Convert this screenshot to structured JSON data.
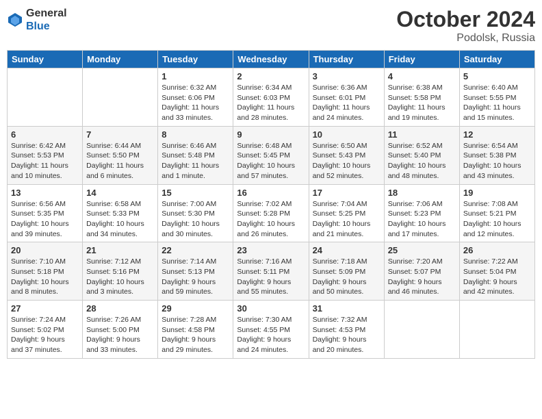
{
  "header": {
    "logo_general": "General",
    "logo_blue": "Blue",
    "month_title": "October 2024",
    "location": "Podolsk, Russia"
  },
  "days_of_week": [
    "Sunday",
    "Monday",
    "Tuesday",
    "Wednesday",
    "Thursday",
    "Friday",
    "Saturday"
  ],
  "weeks": [
    [
      {
        "day": "",
        "info": ""
      },
      {
        "day": "",
        "info": ""
      },
      {
        "day": "1",
        "info": "Sunrise: 6:32 AM\nSunset: 6:06 PM\nDaylight: 11 hours\nand 33 minutes."
      },
      {
        "day": "2",
        "info": "Sunrise: 6:34 AM\nSunset: 6:03 PM\nDaylight: 11 hours\nand 28 minutes."
      },
      {
        "day": "3",
        "info": "Sunrise: 6:36 AM\nSunset: 6:01 PM\nDaylight: 11 hours\nand 24 minutes."
      },
      {
        "day": "4",
        "info": "Sunrise: 6:38 AM\nSunset: 5:58 PM\nDaylight: 11 hours\nand 19 minutes."
      },
      {
        "day": "5",
        "info": "Sunrise: 6:40 AM\nSunset: 5:55 PM\nDaylight: 11 hours\nand 15 minutes."
      }
    ],
    [
      {
        "day": "6",
        "info": "Sunrise: 6:42 AM\nSunset: 5:53 PM\nDaylight: 11 hours\nand 10 minutes."
      },
      {
        "day": "7",
        "info": "Sunrise: 6:44 AM\nSunset: 5:50 PM\nDaylight: 11 hours\nand 6 minutes."
      },
      {
        "day": "8",
        "info": "Sunrise: 6:46 AM\nSunset: 5:48 PM\nDaylight: 11 hours\nand 1 minute."
      },
      {
        "day": "9",
        "info": "Sunrise: 6:48 AM\nSunset: 5:45 PM\nDaylight: 10 hours\nand 57 minutes."
      },
      {
        "day": "10",
        "info": "Sunrise: 6:50 AM\nSunset: 5:43 PM\nDaylight: 10 hours\nand 52 minutes."
      },
      {
        "day": "11",
        "info": "Sunrise: 6:52 AM\nSunset: 5:40 PM\nDaylight: 10 hours\nand 48 minutes."
      },
      {
        "day": "12",
        "info": "Sunrise: 6:54 AM\nSunset: 5:38 PM\nDaylight: 10 hours\nand 43 minutes."
      }
    ],
    [
      {
        "day": "13",
        "info": "Sunrise: 6:56 AM\nSunset: 5:35 PM\nDaylight: 10 hours\nand 39 minutes."
      },
      {
        "day": "14",
        "info": "Sunrise: 6:58 AM\nSunset: 5:33 PM\nDaylight: 10 hours\nand 34 minutes."
      },
      {
        "day": "15",
        "info": "Sunrise: 7:00 AM\nSunset: 5:30 PM\nDaylight: 10 hours\nand 30 minutes."
      },
      {
        "day": "16",
        "info": "Sunrise: 7:02 AM\nSunset: 5:28 PM\nDaylight: 10 hours\nand 26 minutes."
      },
      {
        "day": "17",
        "info": "Sunrise: 7:04 AM\nSunset: 5:25 PM\nDaylight: 10 hours\nand 21 minutes."
      },
      {
        "day": "18",
        "info": "Sunrise: 7:06 AM\nSunset: 5:23 PM\nDaylight: 10 hours\nand 17 minutes."
      },
      {
        "day": "19",
        "info": "Sunrise: 7:08 AM\nSunset: 5:21 PM\nDaylight: 10 hours\nand 12 minutes."
      }
    ],
    [
      {
        "day": "20",
        "info": "Sunrise: 7:10 AM\nSunset: 5:18 PM\nDaylight: 10 hours\nand 8 minutes."
      },
      {
        "day": "21",
        "info": "Sunrise: 7:12 AM\nSunset: 5:16 PM\nDaylight: 10 hours\nand 3 minutes."
      },
      {
        "day": "22",
        "info": "Sunrise: 7:14 AM\nSunset: 5:13 PM\nDaylight: 9 hours\nand 59 minutes."
      },
      {
        "day": "23",
        "info": "Sunrise: 7:16 AM\nSunset: 5:11 PM\nDaylight: 9 hours\nand 55 minutes."
      },
      {
        "day": "24",
        "info": "Sunrise: 7:18 AM\nSunset: 5:09 PM\nDaylight: 9 hours\nand 50 minutes."
      },
      {
        "day": "25",
        "info": "Sunrise: 7:20 AM\nSunset: 5:07 PM\nDaylight: 9 hours\nand 46 minutes."
      },
      {
        "day": "26",
        "info": "Sunrise: 7:22 AM\nSunset: 5:04 PM\nDaylight: 9 hours\nand 42 minutes."
      }
    ],
    [
      {
        "day": "27",
        "info": "Sunrise: 7:24 AM\nSunset: 5:02 PM\nDaylight: 9 hours\nand 37 minutes."
      },
      {
        "day": "28",
        "info": "Sunrise: 7:26 AM\nSunset: 5:00 PM\nDaylight: 9 hours\nand 33 minutes."
      },
      {
        "day": "29",
        "info": "Sunrise: 7:28 AM\nSunset: 4:58 PM\nDaylight: 9 hours\nand 29 minutes."
      },
      {
        "day": "30",
        "info": "Sunrise: 7:30 AM\nSunset: 4:55 PM\nDaylight: 9 hours\nand 24 minutes."
      },
      {
        "day": "31",
        "info": "Sunrise: 7:32 AM\nSunset: 4:53 PM\nDaylight: 9 hours\nand 20 minutes."
      },
      {
        "day": "",
        "info": ""
      },
      {
        "day": "",
        "info": ""
      }
    ]
  ]
}
